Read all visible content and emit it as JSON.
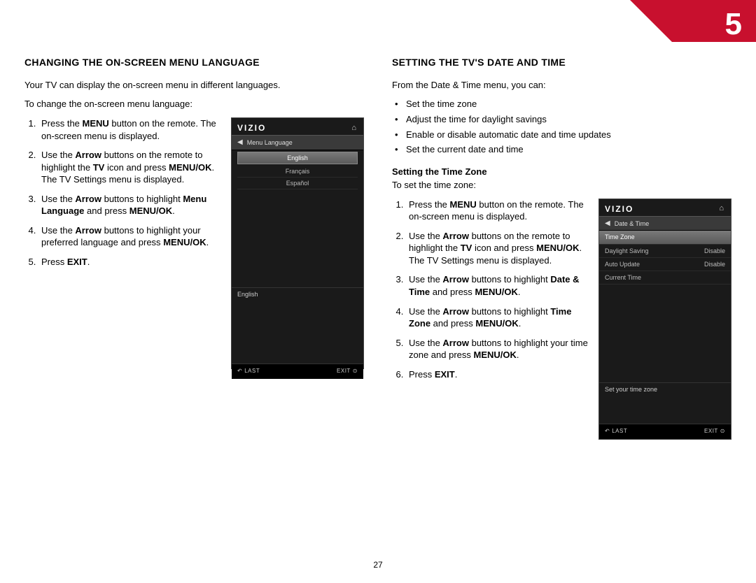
{
  "chapter_number": "5",
  "page_number": "27",
  "left": {
    "heading": "CHANGING THE ON-SCREEN MENU LANGUAGE",
    "intro1": "Your TV can display the on-screen menu in different languages.",
    "intro2": "To change the on-screen menu language:",
    "step1_a": "Press the ",
    "step1_b": "MENU",
    "step1_c": " button on the remote. The on-screen menu is displayed.",
    "step2_a": "Use the ",
    "step2_b": "Arrow",
    "step2_c": " buttons on the remote to highlight the ",
    "step2_d": "TV",
    "step2_e": " icon and press ",
    "step2_f": "MENU/OK",
    "step2_g": ". The TV Settings menu is displayed.",
    "step3_a": "Use the ",
    "step3_b": "Arrow",
    "step3_c": " buttons to highlight ",
    "step3_d": "Menu Language",
    "step3_e": " and press ",
    "step3_f": "MENU/OK",
    "step3_g": ".",
    "step4_a": "Use the ",
    "step4_b": "Arrow",
    "step4_c": " buttons to highlight your preferred language and press ",
    "step4_d": "MENU/OK",
    "step4_e": ".",
    "step5_a": "Press ",
    "step5_b": "EXIT",
    "step5_c": "."
  },
  "right": {
    "heading": "SETTING THE TV'S DATE AND TIME",
    "intro": "From the Date & Time menu, you can:",
    "bullet1": "Set the time zone",
    "bullet2": "Adjust the time for daylight savings",
    "bullet3": "Enable or disable automatic date and time updates",
    "bullet4": "Set the current date and time",
    "subhead": "Setting the Time Zone",
    "intro2": "To set the time zone:",
    "step1_a": "Press the ",
    "step1_b": "MENU",
    "step1_c": " button on the remote. The on-screen menu is displayed.",
    "step2_a": "Use the ",
    "step2_b": "Arrow",
    "step2_c": " buttons on the remote to highlight the ",
    "step2_d": "TV",
    "step2_e": " icon and press ",
    "step2_f": "MENU/OK",
    "step2_g": ". The TV Settings menu is displayed.",
    "step3_a": "Use the ",
    "step3_b": "Arrow",
    "step3_c": " buttons to highlight ",
    "step3_d": "Date & Time",
    "step3_e": " and press ",
    "step3_f": "MENU/OK",
    "step3_g": ".",
    "step4_a": "Use the ",
    "step4_b": "Arrow",
    "step4_c": " buttons to highlight ",
    "step4_d": "Time Zone",
    "step4_e": " and press ",
    "step4_f": "MENU/OK",
    "step4_g": ".",
    "step5_a": "Use the ",
    "step5_b": "Arrow",
    "step5_c": " buttons to highlight your time zone and press ",
    "step5_d": "MENU/OK",
    "step5_e": ".",
    "step6_a": "Press ",
    "step6_b": "EXIT",
    "step6_c": "."
  },
  "tv1": {
    "brand": "VIZIO",
    "crumb": "Menu Language",
    "opt1": "English",
    "opt2": "Français",
    "opt3": "Español",
    "status": "English",
    "last_icon": "↶",
    "last": "LAST",
    "exit": "EXIT",
    "exit_icon": "⊙"
  },
  "tv2": {
    "brand": "VIZIO",
    "crumb": "Date & Time",
    "row1_l": "Time Zone",
    "row2_l": "Daylight Saving",
    "row2_r": "Disable",
    "row3_l": "Auto Update",
    "row3_r": "Disable",
    "row4_l": "Current Time",
    "status": "Set your time zone",
    "last_icon": "↶",
    "last": "LAST",
    "exit": "EXIT",
    "exit_icon": "⊙"
  }
}
